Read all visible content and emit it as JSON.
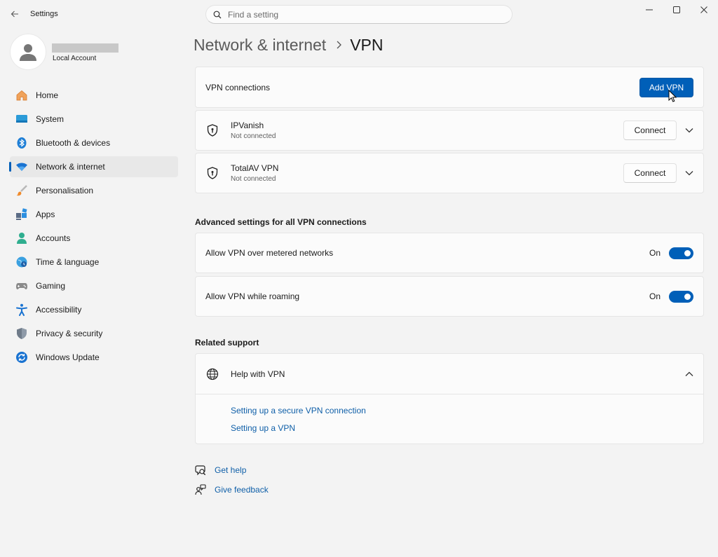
{
  "window": {
    "title": "Settings",
    "controls": [
      "minimize",
      "maximize",
      "close"
    ]
  },
  "search": {
    "placeholder": "Find a setting",
    "value": ""
  },
  "profile": {
    "account_type": "Local Account"
  },
  "sidebar": {
    "active_index": 3,
    "items": [
      {
        "label": "Home",
        "icon": "home-icon"
      },
      {
        "label": "System",
        "icon": "system-icon"
      },
      {
        "label": "Bluetooth & devices",
        "icon": "bluetooth-icon"
      },
      {
        "label": "Network & internet",
        "icon": "wifi-icon"
      },
      {
        "label": "Personalisation",
        "icon": "brush-icon"
      },
      {
        "label": "Apps",
        "icon": "apps-icon"
      },
      {
        "label": "Accounts",
        "icon": "accounts-icon"
      },
      {
        "label": "Time & language",
        "icon": "globe-clock-icon"
      },
      {
        "label": "Gaming",
        "icon": "gamepad-icon"
      },
      {
        "label": "Accessibility",
        "icon": "accessibility-icon"
      },
      {
        "label": "Privacy & security",
        "icon": "shield-icon"
      },
      {
        "label": "Windows Update",
        "icon": "update-icon"
      }
    ]
  },
  "breadcrumb": {
    "parent": "Network & internet",
    "current": "VPN"
  },
  "vpn": {
    "header_label": "VPN connections",
    "add_button": "Add VPN",
    "connections": [
      {
        "name": "IPVanish",
        "status": "Not connected",
        "button": "Connect"
      },
      {
        "name": "TotalAV VPN",
        "status": "Not connected",
        "button": "Connect"
      }
    ]
  },
  "advanced": {
    "title": "Advanced settings for all VPN connections",
    "settings": [
      {
        "label": "Allow VPN over metered networks",
        "state": "On",
        "enabled": true
      },
      {
        "label": "Allow VPN while roaming",
        "state": "On",
        "enabled": true
      }
    ]
  },
  "related": {
    "title": "Related support",
    "help_title": "Help with VPN",
    "expanded": true,
    "links": [
      "Setting up a secure VPN connection",
      "Setting up a VPN"
    ]
  },
  "footer": {
    "get_help": "Get help",
    "give_feedback": "Give feedback"
  },
  "colors": {
    "accent": "#005fb8",
    "link": "#0f5fa8",
    "background": "#f3f3f3",
    "card": "#fbfbfb"
  }
}
